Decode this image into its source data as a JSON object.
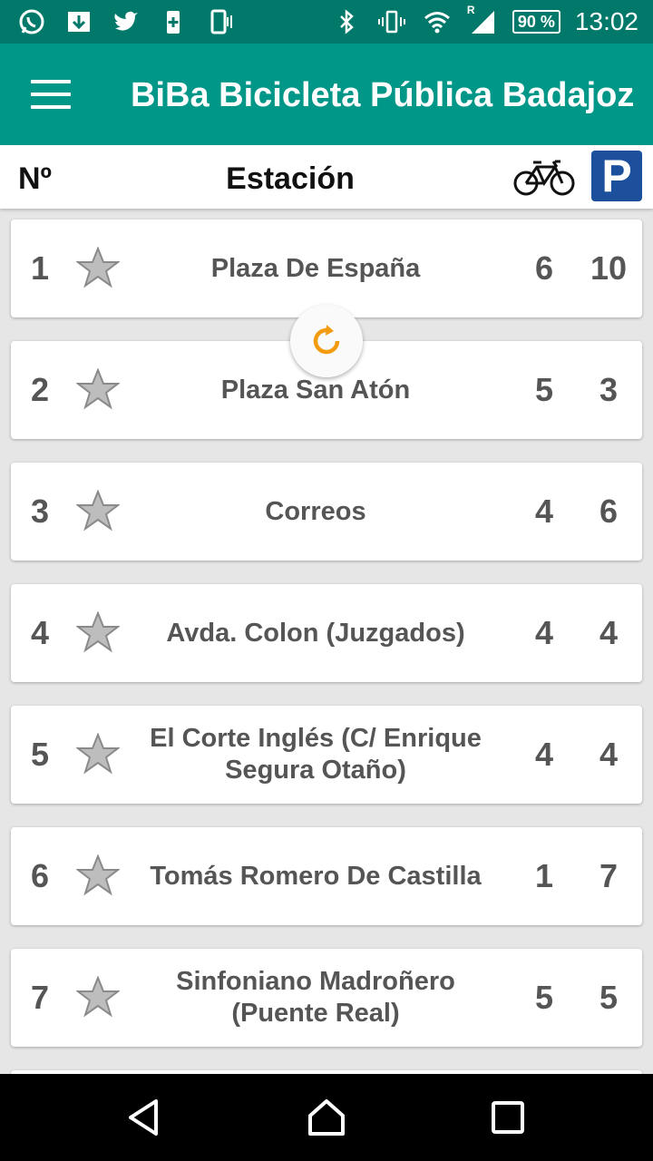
{
  "status_bar": {
    "time": "13:02",
    "battery": "90 %",
    "roaming": "R",
    "icons_left": [
      "whatsapp-icon",
      "download-icon",
      "twitter-icon",
      "battery-plus-icon",
      "phone-vibrate-icon"
    ],
    "icons_right": [
      "bluetooth-icon",
      "vibrate-icon",
      "wifi-icon",
      "signal-icon",
      "battery-icon"
    ]
  },
  "app_bar": {
    "title": "BiBa Bicicleta Pública Badajoz",
    "background": "#009688"
  },
  "columns": {
    "number": "Nº",
    "station": "Estación",
    "bikes_icon": "bicycle-icon",
    "parking_icon": "parking-icon",
    "parking_letter": "P"
  },
  "stations": [
    {
      "num": "1",
      "name": "Plaza De España",
      "bikes": "6",
      "slots": "10"
    },
    {
      "num": "2",
      "name": "Plaza San Atón",
      "bikes": "5",
      "slots": "3"
    },
    {
      "num": "3",
      "name": "Correos",
      "bikes": "4",
      "slots": "6"
    },
    {
      "num": "4",
      "name": "Avda. Colon (Juzgados)",
      "bikes": "4",
      "slots": "4"
    },
    {
      "num": "5",
      "name": "El Corte Inglés (C/ Enrique Segura Otaño)",
      "bikes": "4",
      "slots": "4"
    },
    {
      "num": "6",
      "name": "Tomás Romero De Castilla",
      "bikes": "1",
      "slots": "7"
    },
    {
      "num": "7",
      "name": "Sinfoniano Madroñero (Puente Real)",
      "bikes": "5",
      "slots": "5"
    }
  ],
  "colors": {
    "status_bar": "#00796b",
    "accent_refresh": "#f39c12",
    "parking": "#1c4f9c"
  }
}
